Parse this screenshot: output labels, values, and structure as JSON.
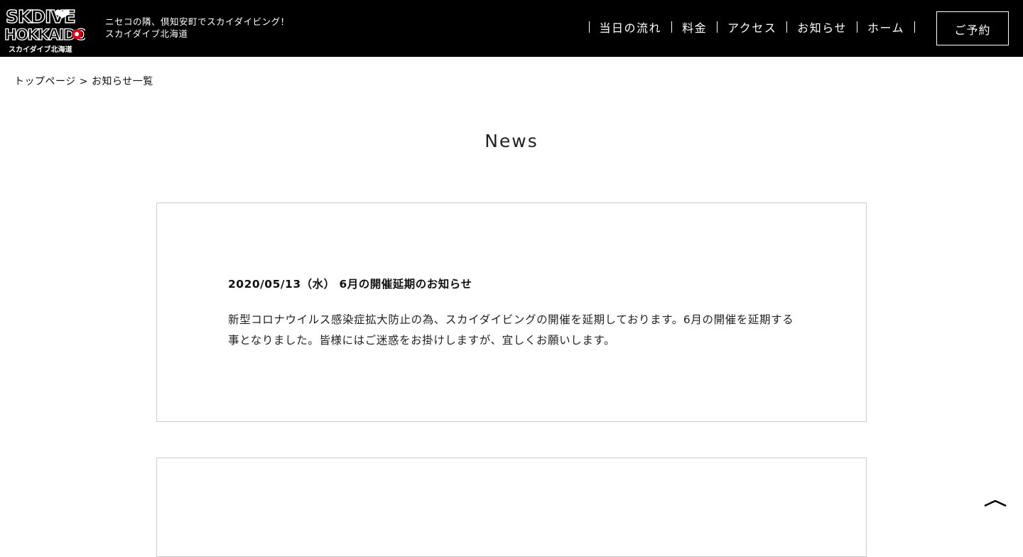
{
  "header": {
    "logo_text_line1": "SKDIVE",
    "logo_text_line2": "HOKKAIDO",
    "logo_caption": "スカイダイブ北海道",
    "tagline_line1": "ニセコの隣、倶知安町でスカイダイビング！",
    "tagline_line2": "スカイダイブ北海道",
    "nav": [
      {
        "label": "当日の流れ"
      },
      {
        "label": "料金"
      },
      {
        "label": "アクセス"
      },
      {
        "label": "お知らせ"
      },
      {
        "label": "ホーム"
      }
    ],
    "reserve_label": "ご予約"
  },
  "breadcrumb": {
    "home": "トップページ",
    "separator": ">",
    "current": "お知らせ一覧"
  },
  "page": {
    "title": "News"
  },
  "news": [
    {
      "title": "2020/05/13（水） 6月の開催延期のお知らせ",
      "body": "新型コロナウイルス感染症拡大防止の為、スカイダイビングの開催を延期しております。6月の開催を延期する事となりました。皆様にはご迷惑をお掛けしますが、宜しくお願いします。"
    }
  ],
  "icons": {
    "back_to_top": "chevron-up-icon"
  },
  "colors": {
    "header_bg": "#000000",
    "header_text": "#ffffff",
    "logo_accent": "#e60012",
    "card_border": "#cccccc"
  }
}
